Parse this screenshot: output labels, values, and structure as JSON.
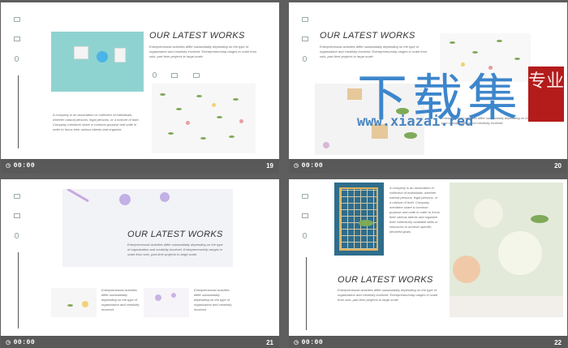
{
  "heading": "OUR LATEST WORKS",
  "body_text": "Entrepreneurial activities differ substantially depending on the type of organization and creativity involved. Entrepreneurship ranges in scale from solo, part-time projects to large-scale.",
  "company_text": "A company is an association or collection of individuals, whether natural persons, legal persons, or a mixture of both. Company members share a common purpose and unite in order to focus their various talents and organize.",
  "company_text_long": "A company is an association or collection of individuals, whether natural persons, legal persons, or a mixture of both. Company members share a common purpose and unite in order to focus their various talents and organize their collectively available skills or resources to achieve specific, declared goals.",
  "caption_a": "Entrepreneurial activities differ substantially depending on the type of organization and creativity involved.",
  "caption_b": "Entrepreneurial activities differ substantially depending on the type of organization and creativity involved.",
  "slides": [
    {
      "time": "00:00",
      "number": "19"
    },
    {
      "time": "00:00",
      "number": "20"
    },
    {
      "time": "00:00",
      "number": "21"
    },
    {
      "time": "00:00",
      "number": "22"
    }
  ],
  "watermark": {
    "main": "下载集",
    "url": "www.xiazai.red",
    "seal": "专业"
  },
  "colors": {
    "background": "#5e5e5e",
    "bar": "#595959",
    "title": "#333333",
    "watermark_blue": "#3d86cc",
    "seal_red": "#b41b1b"
  }
}
